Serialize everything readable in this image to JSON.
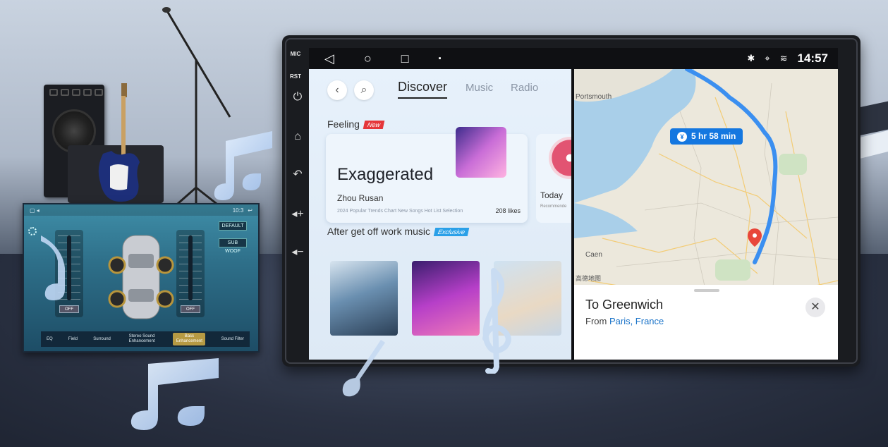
{
  "device": {
    "side_buttons": [
      "MIC",
      "RST"
    ],
    "side_icons": [
      "power-icon",
      "home-icon",
      "back-icon",
      "volume-up-icon",
      "volume-down-icon"
    ]
  },
  "statusbar": {
    "nav_icons": [
      "back-triangle-icon",
      "home-circle-icon",
      "recents-square-icon",
      "screenshot-icon"
    ],
    "status_icons": [
      "bluetooth-icon",
      "location-icon",
      "wifi-icon"
    ],
    "time": "14:57"
  },
  "music": {
    "tabs": [
      {
        "label": "Discover",
        "active": true
      },
      {
        "label": "Music",
        "active": false
      },
      {
        "label": "Radio",
        "active": false
      }
    ],
    "feeling_title": "Feeling",
    "feeling_badge": "New",
    "featured": {
      "title": "Exaggerated",
      "artist": "Zhou Rusan",
      "description": "2024 Popular Trends Chart New Songs Hot List Selection",
      "likes": "208 likes"
    },
    "side_card": {
      "title": "Today",
      "subtitle": "Recommende"
    },
    "section2_title": "After get off work music",
    "section2_badge": "Exclusive"
  },
  "map": {
    "duration": "5 hr 58 min",
    "places": [
      "Portsmouth",
      "Caen",
      "高德地图"
    ],
    "destination": "To Greenwich",
    "from_label": "From",
    "from_place": "Paris, France"
  },
  "eq_panel": {
    "time": "10:3",
    "buttons": [
      "DEFAULT",
      "SUB WOOF"
    ],
    "off_left": "OFF",
    "off_right": "OFF",
    "tabs": [
      "EQ",
      "Field",
      "Surround",
      "Stereo Sound Enhancement",
      "Bass Enhancement",
      "Sound Filter"
    ],
    "active_tab": "Bass Enhancement"
  },
  "colors": {
    "accent_blue": "#1477e0",
    "new_badge": "#e5363a",
    "exclusive_badge": "#2aa0e8",
    "route": "#3b8ff0"
  }
}
